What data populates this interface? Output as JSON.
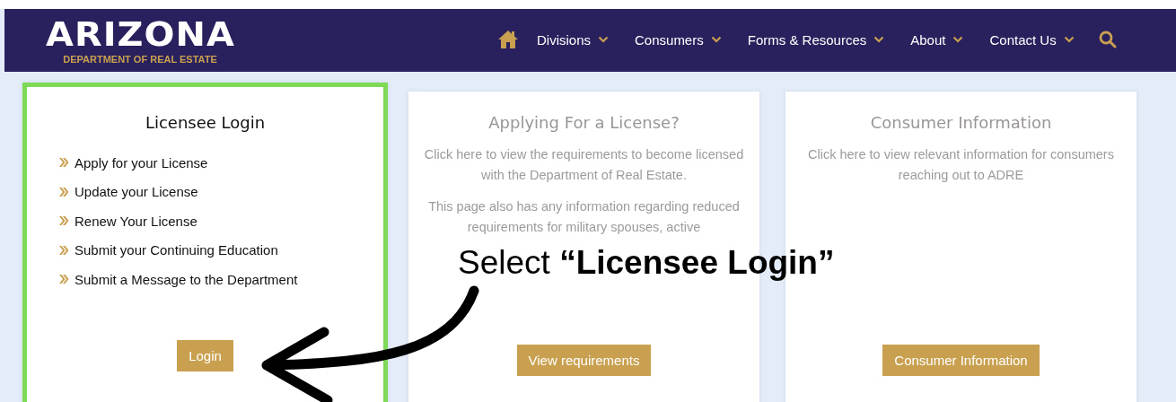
{
  "header": {
    "logo": "ARIZONA",
    "subtitle": "DEPARTMENT OF REAL ESTATE",
    "nav": [
      {
        "label": "Divisions"
      },
      {
        "label": "Consumers"
      },
      {
        "label": "Forms & Resources"
      },
      {
        "label": "About"
      },
      {
        "label": "Contact Us"
      }
    ]
  },
  "cards": [
    {
      "kind": "links",
      "highlighted": true,
      "faded": false,
      "title": "Licensee Login",
      "links": [
        "Apply for your License",
        "Update your License",
        "Renew Your License",
        "Submit your Continuing Education",
        "Submit a Message to the Department"
      ],
      "button": "Login"
    },
    {
      "kind": "text",
      "highlighted": false,
      "faded": true,
      "title": "Applying For a License?",
      "paragraphs": [
        "Click here to view the requirements to become licensed with the Department of Real Estate.",
        "This page also has any information regarding reduced requirements for military spouses, active"
      ],
      "button": "View requirements"
    },
    {
      "kind": "text",
      "highlighted": false,
      "faded": true,
      "title": "Consumer Information",
      "paragraphs": [
        "Click here to view relevant information for consumers reaching out to ADRE"
      ],
      "button": "Consumer Information"
    }
  ],
  "annotation": {
    "text": "Select **“Licensee Login”**"
  }
}
